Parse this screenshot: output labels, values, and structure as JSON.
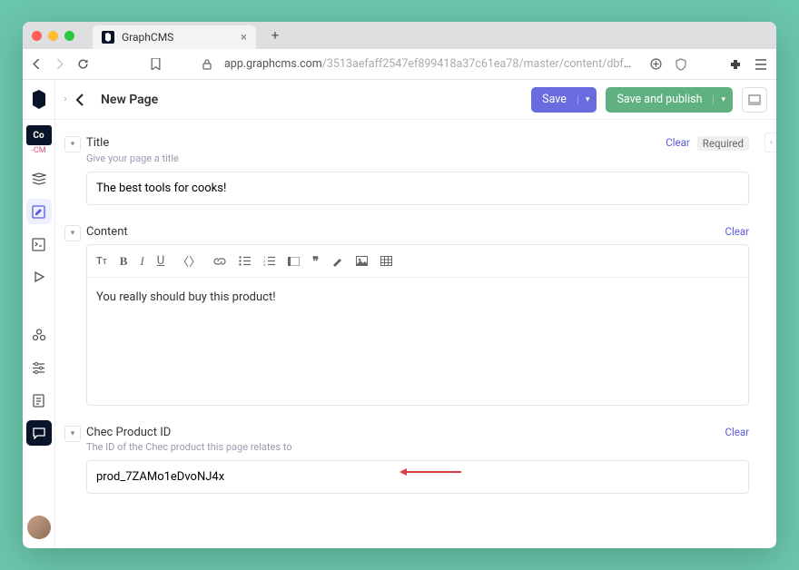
{
  "browser": {
    "tab_title": "GraphCMS",
    "url_host": "app.graphcms.com",
    "url_path": "/3513aefaff2547ef899418a37c61ea78/master/content/dbf5be2268b94..."
  },
  "header": {
    "page_title": "New Page",
    "save_label": "Save",
    "publish_label": "Save and publish"
  },
  "sidebar": {
    "co_label": "Co",
    "cm_label": "-CM"
  },
  "fields": {
    "title": {
      "label": "Title",
      "help": "Give your page a title",
      "clear": "Clear",
      "required": "Required",
      "value": "The best tools for cooks!"
    },
    "content": {
      "label": "Content",
      "clear": "Clear",
      "value": "You really should buy this product!"
    },
    "chec": {
      "label": "Chec Product ID",
      "help": "The ID of the Chec product this page relates to",
      "clear": "Clear",
      "value": "prod_7ZAMo1eDvoNJ4x"
    }
  }
}
